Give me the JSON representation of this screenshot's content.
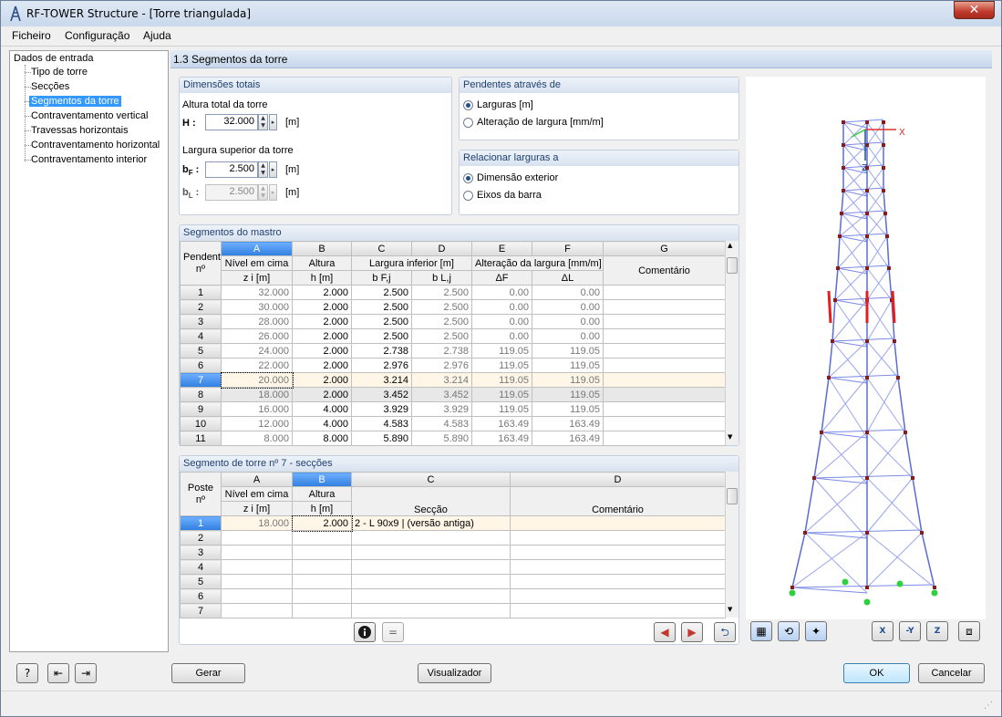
{
  "window": {
    "title": "RF-TOWER Structure - [Torre triangulada]",
    "close": "✕"
  },
  "menu": [
    "Ficheiro",
    "Configuração",
    "Ajuda"
  ],
  "tree": {
    "root": "Dados de entrada",
    "items": [
      "Tipo de torre",
      "Secções",
      "Segmentos da torre",
      "Contraventamento vertical",
      "Travessas horizontais",
      "Contraventamento horizontal",
      "Contraventamento interior"
    ],
    "selected_index": 2
  },
  "section_title": "1.3 Segmentos da torre",
  "dimensions": {
    "title": "Dimensões totais",
    "height_label": "Altura total da torre",
    "H_label": "H :",
    "H_value": "32.000",
    "unit": "[m]",
    "top_width_label": "Largura superior da torre",
    "bF_label": "b",
    "bF_sub": "F",
    "bF_value": "2.500",
    "bL_label": "b",
    "bL_sub": "L",
    "bL_value": "2.500"
  },
  "slopes": {
    "title": "Pendentes através de",
    "options": [
      "Larguras [m]",
      "Alteração de largura [mm/m]"
    ],
    "selected": 0
  },
  "relate": {
    "title": "Relacionar larguras a",
    "options": [
      "Dimensão exterior",
      "Eixos da barra"
    ],
    "selected": 0
  },
  "mast": {
    "title": "Segmentos do mastro",
    "col_letters": [
      "A",
      "B",
      "C",
      "D",
      "E",
      "F",
      "G"
    ],
    "head1": [
      "Pendente",
      "Nível em cima",
      "Altura",
      "Largura inferior [m]",
      "Alteração da largura [mm/m]",
      "",
      "Comentário"
    ],
    "head2": [
      "nº",
      "z i [m]",
      "h [m]",
      "b F,j",
      "b L,j",
      "ΔF",
      "ΔL"
    ],
    "rows": [
      [
        "1",
        "32.000",
        "2.000",
        "2.500",
        "2.500",
        "0.00",
        "0.00",
        ""
      ],
      [
        "2",
        "30.000",
        "2.000",
        "2.500",
        "2.500",
        "0.00",
        "0.00",
        ""
      ],
      [
        "3",
        "28.000",
        "2.000",
        "2.500",
        "2.500",
        "0.00",
        "0.00",
        ""
      ],
      [
        "4",
        "26.000",
        "2.000",
        "2.500",
        "2.500",
        "0.00",
        "0.00",
        ""
      ],
      [
        "5",
        "24.000",
        "2.000",
        "2.738",
        "2.738",
        "119.05",
        "119.05",
        ""
      ],
      [
        "6",
        "22.000",
        "2.000",
        "2.976",
        "2.976",
        "119.05",
        "119.05",
        ""
      ],
      [
        "7",
        "20.000",
        "2.000",
        "3.214",
        "3.214",
        "119.05",
        "119.05",
        ""
      ],
      [
        "8",
        "18.000",
        "2.000",
        "3.452",
        "3.452",
        "119.05",
        "119.05",
        ""
      ],
      [
        "9",
        "16.000",
        "4.000",
        "3.929",
        "3.929",
        "119.05",
        "119.05",
        ""
      ],
      [
        "10",
        "12.000",
        "4.000",
        "4.583",
        "4.583",
        "163.49",
        "163.49",
        ""
      ],
      [
        "11",
        "8.000",
        "8.000",
        "5.890",
        "5.890",
        "163.49",
        "163.49",
        ""
      ]
    ],
    "selected_row": 6
  },
  "sections": {
    "title": "Segmento de torre nº 7  -  secções",
    "col_letters": [
      "A",
      "B",
      "C",
      "D"
    ],
    "head1": [
      "Poste",
      "Nível em cima",
      "Altura",
      "",
      ""
    ],
    "head2": [
      "nº",
      "z i [m]",
      "h [m]",
      "Secção",
      "Comentário"
    ],
    "rows": [
      [
        "1",
        "18.000",
        "2.000",
        "2 - L 90x9 | (versão antiga)",
        ""
      ],
      [
        "2",
        "",
        "",
        "",
        ""
      ],
      [
        "3",
        "",
        "",
        "",
        ""
      ],
      [
        "4",
        "",
        "",
        "",
        ""
      ],
      [
        "5",
        "",
        "",
        "",
        ""
      ],
      [
        "6",
        "",
        "",
        "",
        ""
      ],
      [
        "7",
        "",
        "",
        "",
        ""
      ]
    ]
  },
  "axes": {
    "x": "X",
    "z": "Z"
  },
  "buttons": {
    "gerar": "Gerar",
    "visualizador": "Visualizador",
    "ok": "OK",
    "cancelar": "Cancelar"
  },
  "preview_tools": [
    "X",
    "-Y",
    "Z"
  ]
}
